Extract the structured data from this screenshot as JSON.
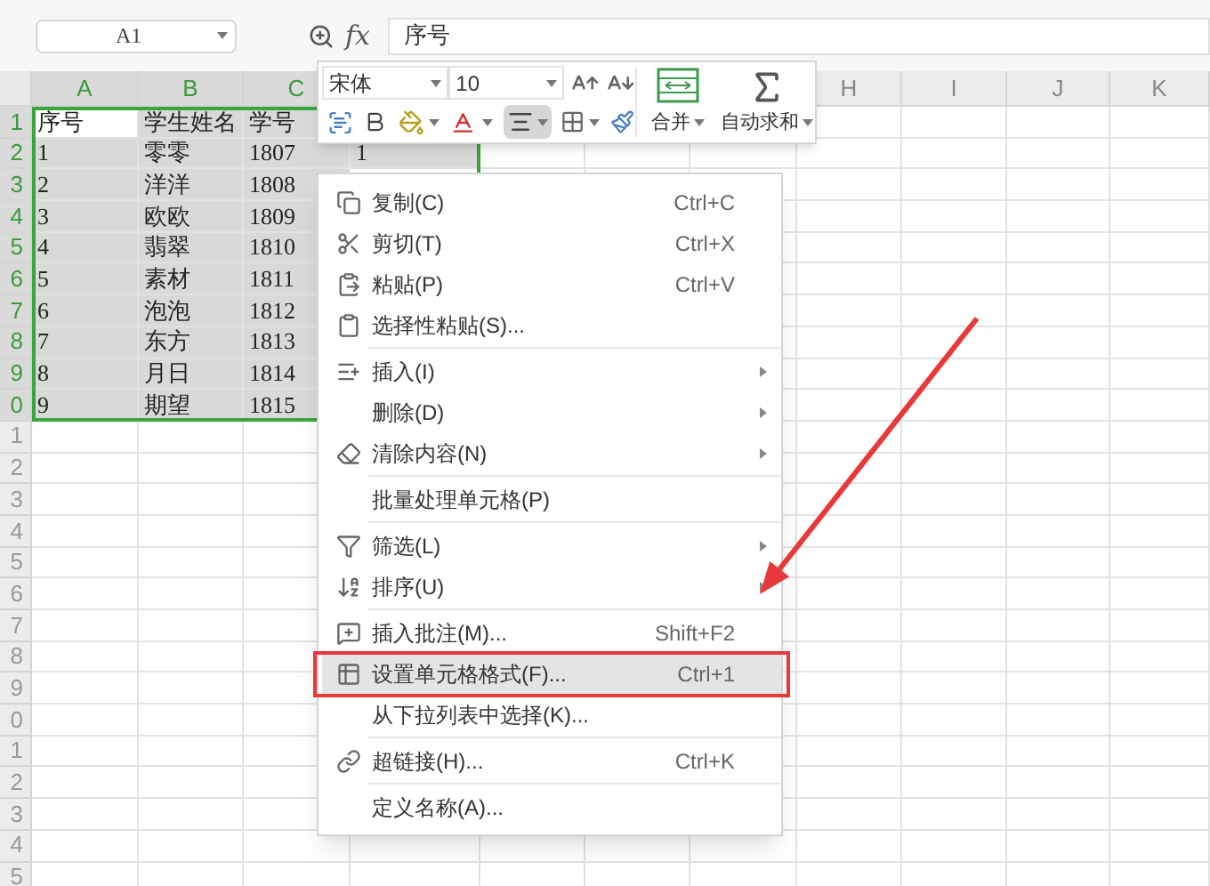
{
  "name_box": {
    "value": "A1"
  },
  "formula_bar": {
    "fx": "fx",
    "value": "序号"
  },
  "columns": [
    {
      "label": "A",
      "selected": true
    },
    {
      "label": "B",
      "selected": true
    },
    {
      "label": "C",
      "selected": true
    },
    {
      "label": "H",
      "selected": false
    },
    {
      "label": "I",
      "selected": false
    },
    {
      "label": "J",
      "selected": false
    },
    {
      "label": "K",
      "selected": false
    }
  ],
  "rows": [
    {
      "number": "1",
      "selected": true,
      "cells": [
        {
          "text": "序号",
          "selected": true,
          "active": true
        },
        {
          "text": "学生姓名",
          "selected": true,
          "active": false
        },
        {
          "text": "学号",
          "selected": true,
          "active": false
        }
      ]
    },
    {
      "number": "2",
      "selected": true,
      "cells": [
        {
          "text": "1",
          "selected": true,
          "active": false
        },
        {
          "text": "零零",
          "selected": true,
          "active": false
        },
        {
          "text": "1807",
          "selected": true,
          "active": false
        },
        {
          "text": "1",
          "selected": true,
          "active": false
        }
      ]
    },
    {
      "number": "3",
      "selected": true,
      "cells": [
        {
          "text": "2",
          "selected": true,
          "active": false
        },
        {
          "text": "洋洋",
          "selected": true,
          "active": false
        },
        {
          "text": "1808",
          "selected": true,
          "active": false
        }
      ]
    },
    {
      "number": "4",
      "selected": true,
      "cells": [
        {
          "text": "3",
          "selected": true,
          "active": false
        },
        {
          "text": "欧欧",
          "selected": true,
          "active": false
        },
        {
          "text": "1809",
          "selected": true,
          "active": false
        }
      ]
    },
    {
      "number": "5",
      "selected": true,
      "cells": [
        {
          "text": "4",
          "selected": true,
          "active": false
        },
        {
          "text": "翡翠",
          "selected": true,
          "active": false
        },
        {
          "text": "1810",
          "selected": true,
          "active": false
        }
      ]
    },
    {
      "number": "6",
      "selected": true,
      "cells": [
        {
          "text": "5",
          "selected": true,
          "active": false
        },
        {
          "text": "素材",
          "selected": true,
          "active": false
        },
        {
          "text": "1811",
          "selected": true,
          "active": false
        }
      ]
    },
    {
      "number": "7",
      "selected": true,
      "cells": [
        {
          "text": "6",
          "selected": true,
          "active": false
        },
        {
          "text": "泡泡",
          "selected": true,
          "active": false
        },
        {
          "text": "1812",
          "selected": true,
          "active": false
        }
      ]
    },
    {
      "number": "8",
      "selected": true,
      "cells": [
        {
          "text": "7",
          "selected": true,
          "active": false
        },
        {
          "text": "东方",
          "selected": true,
          "active": false
        },
        {
          "text": "1813",
          "selected": true,
          "active": false
        }
      ]
    },
    {
      "number": "9",
      "selected": true,
      "cells": [
        {
          "text": "8",
          "selected": true,
          "active": false
        },
        {
          "text": "月日",
          "selected": true,
          "active": false
        },
        {
          "text": "1814",
          "selected": true,
          "active": false
        }
      ]
    },
    {
      "number": "0",
      "selected": true,
      "cells": [
        {
          "text": "9",
          "selected": true,
          "active": false
        },
        {
          "text": "期望",
          "selected": true,
          "active": false
        },
        {
          "text": "1815",
          "selected": true,
          "active": false
        }
      ]
    },
    {
      "number": "1",
      "selected": false,
      "cells": []
    },
    {
      "number": "2",
      "selected": false,
      "cells": []
    },
    {
      "number": "3",
      "selected": false,
      "cells": []
    },
    {
      "number": "4",
      "selected": false,
      "cells": []
    },
    {
      "number": "5",
      "selected": false,
      "cells": []
    },
    {
      "number": "6",
      "selected": false,
      "cells": []
    },
    {
      "number": "7",
      "selected": false,
      "cells": []
    },
    {
      "number": "8",
      "selected": false,
      "cells": []
    },
    {
      "number": "9",
      "selected": false,
      "cells": []
    },
    {
      "number": "0",
      "selected": false,
      "cells": []
    },
    {
      "number": "1",
      "selected": false,
      "cells": []
    },
    {
      "number": "2",
      "selected": false,
      "cells": []
    },
    {
      "number": "3",
      "selected": false,
      "cells": []
    },
    {
      "number": "4",
      "selected": false,
      "cells": []
    },
    {
      "number": "5",
      "selected": false,
      "cells": []
    }
  ],
  "toolbar": {
    "font": "宋体",
    "size": "10",
    "align_selected": true,
    "merge_label": "合并",
    "sum_label": "自动求和"
  },
  "context_menu": {
    "sections": [
      [
        {
          "label": "复制(C)",
          "shortcut": "Ctrl+C",
          "submenu": false,
          "selected": false
        },
        {
          "label": "剪切(T)",
          "shortcut": "Ctrl+X",
          "submenu": false,
          "selected": false
        },
        {
          "label": "粘贴(P)",
          "shortcut": "Ctrl+V",
          "submenu": false,
          "selected": false
        },
        {
          "label": "选择性粘贴(S)...",
          "submenu": false,
          "selected": false
        }
      ],
      [
        {
          "label": "插入(I)",
          "submenu": true,
          "selected": false
        },
        {
          "label": "删除(D)",
          "submenu": true,
          "selected": false
        },
        {
          "label": "清除内容(N)",
          "submenu": true,
          "selected": false
        }
      ],
      [
        {
          "label": "批量处理单元格(P)",
          "submenu": false,
          "selected": false
        }
      ],
      [
        {
          "label": "筛选(L)",
          "submenu": true,
          "selected": false
        },
        {
          "label": "排序(U)",
          "submenu": true,
          "selected": false
        }
      ],
      [
        {
          "label": "插入批注(M)...",
          "shortcut": "Shift+F2",
          "submenu": false,
          "selected": false
        },
        {
          "label": "设置单元格格式(F)...",
          "shortcut": "Ctrl+1",
          "submenu": false,
          "selected": true
        },
        {
          "label": "从下拉列表中选择(K)...",
          "submenu": false,
          "selected": false
        }
      ],
      [
        {
          "label": "超链接(H)...",
          "shortcut": "Ctrl+K",
          "submenu": false,
          "selected": false
        }
      ],
      [
        {
          "label": "定义名称(A)...",
          "submenu": false,
          "selected": false
        }
      ]
    ]
  }
}
